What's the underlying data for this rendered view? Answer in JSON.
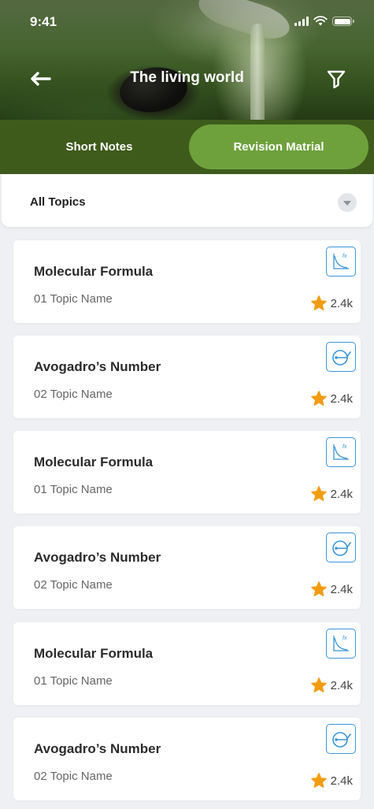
{
  "status_bar": {
    "time": "9:41"
  },
  "header": {
    "title": "The living world",
    "back_icon": "arrow-left-icon",
    "filter_icon": "funnel-icon"
  },
  "tabs": [
    {
      "label": "Short Notes",
      "active": false
    },
    {
      "label": "Revision Matrial",
      "active": true
    }
  ],
  "topic_filter": {
    "selected": "All Topics"
  },
  "colors": {
    "accent_green": "#6ea13c",
    "tab_bar": "#3e5b1b",
    "icon_blue": "#3a95d8",
    "star": "#f39c12"
  },
  "cards": [
    {
      "title": "Molecular Formula",
      "subtitle": "01 Topic Name",
      "rating": "2.4k",
      "icon": "formula-graph-icon"
    },
    {
      "title": "Avogadro’s Number",
      "subtitle": "02 Topic Name",
      "rating": "2.4k",
      "icon": "target-circle-icon"
    },
    {
      "title": "Molecular Formula",
      "subtitle": "01 Topic Name",
      "rating": "2.4k",
      "icon": "formula-graph-icon"
    },
    {
      "title": "Avogadro’s Number",
      "subtitle": "02 Topic Name",
      "rating": "2.4k",
      "icon": "target-circle-icon"
    },
    {
      "title": "Molecular Formula",
      "subtitle": "01 Topic Name",
      "rating": "2.4k",
      "icon": "formula-graph-icon"
    },
    {
      "title": "Avogadro’s Number",
      "subtitle": "02 Topic Name",
      "rating": "2.4k",
      "icon": "target-circle-icon"
    }
  ]
}
